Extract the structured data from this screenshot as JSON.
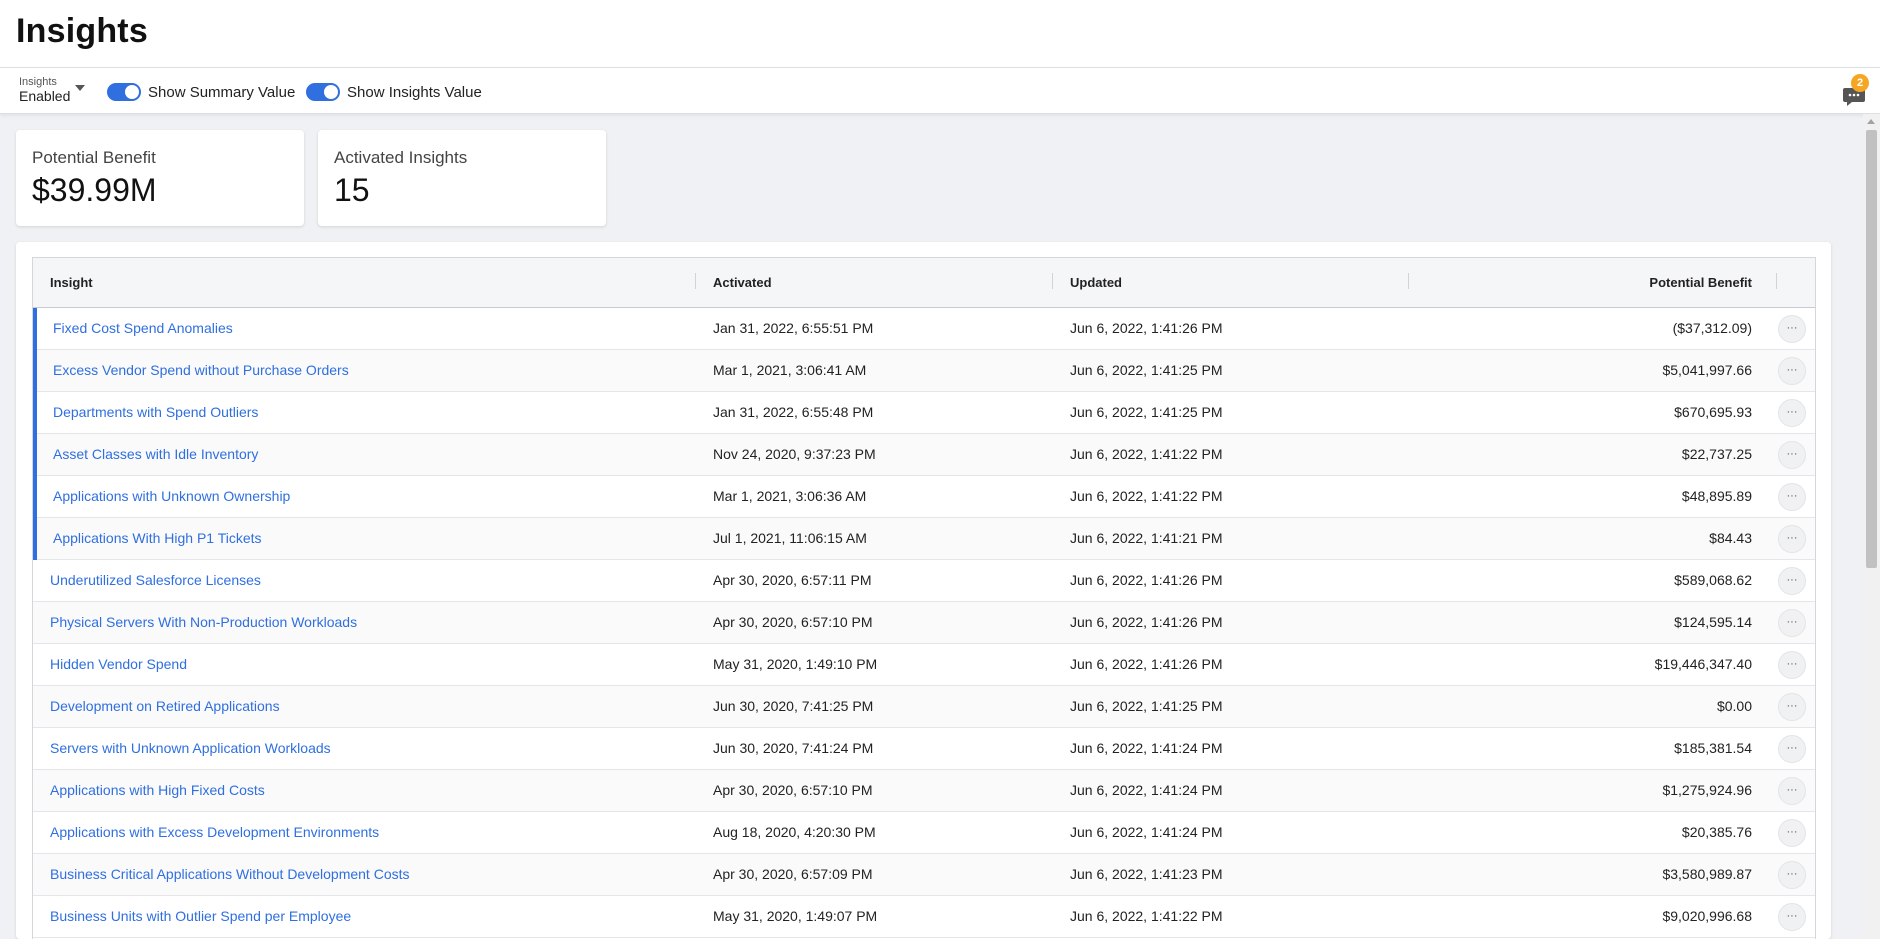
{
  "page": {
    "title": "Insights"
  },
  "toolbar": {
    "dropdown": {
      "label": "Insights",
      "value": "Enabled"
    },
    "toggles": [
      {
        "label": "Show Summary Value",
        "on": true
      },
      {
        "label": "Show Insights Value",
        "on": true
      }
    ],
    "notifications": {
      "count": "2",
      "icon": "chat-icon"
    }
  },
  "summary": {
    "potential_benefit": {
      "label": "Potential Benefit",
      "value": "$39.99M"
    },
    "activated_insights": {
      "label": "Activated Insights",
      "value": "15"
    }
  },
  "table": {
    "columns": [
      "Insight",
      "Activated",
      "Updated",
      "Potential Benefit"
    ],
    "rows": [
      {
        "insight": "Fixed Cost Spend Anomalies",
        "activated": "Jan 31, 2022, 6:55:51 PM",
        "updated": "Jun 6, 2022, 1:41:26 PM",
        "benefit": "($37,312.09)",
        "new": true
      },
      {
        "insight": "Excess Vendor Spend without Purchase Orders",
        "activated": "Mar 1, 2021, 3:06:41 AM",
        "updated": "Jun 6, 2022, 1:41:25 PM",
        "benefit": "$5,041,997.66",
        "new": true
      },
      {
        "insight": "Departments with Spend Outliers",
        "activated": "Jan 31, 2022, 6:55:48 PM",
        "updated": "Jun 6, 2022, 1:41:25 PM",
        "benefit": "$670,695.93",
        "new": true
      },
      {
        "insight": "Asset Classes with Idle Inventory",
        "activated": "Nov 24, 2020, 9:37:23 PM",
        "updated": "Jun 6, 2022, 1:41:22 PM",
        "benefit": "$22,737.25",
        "new": true
      },
      {
        "insight": "Applications with Unknown Ownership",
        "activated": "Mar 1, 2021, 3:06:36 AM",
        "updated": "Jun 6, 2022, 1:41:22 PM",
        "benefit": "$48,895.89",
        "new": true
      },
      {
        "insight": "Applications With High P1 Tickets",
        "activated": "Jul 1, 2021, 11:06:15 AM",
        "updated": "Jun 6, 2022, 1:41:21 PM",
        "benefit": "$84.43",
        "new": true
      },
      {
        "insight": "Underutilized Salesforce Licenses",
        "activated": "Apr 30, 2020, 6:57:11 PM",
        "updated": "Jun 6, 2022, 1:41:26 PM",
        "benefit": "$589,068.62",
        "new": false
      },
      {
        "insight": "Physical Servers With Non-Production Workloads",
        "activated": "Apr 30, 2020, 6:57:10 PM",
        "updated": "Jun 6, 2022, 1:41:26 PM",
        "benefit": "$124,595.14",
        "new": false
      },
      {
        "insight": "Hidden Vendor Spend",
        "activated": "May 31, 2020, 1:49:10 PM",
        "updated": "Jun 6, 2022, 1:41:26 PM",
        "benefit": "$19,446,347.40",
        "new": false
      },
      {
        "insight": "Development on Retired Applications",
        "activated": "Jun 30, 2020, 7:41:25 PM",
        "updated": "Jun 6, 2022, 1:41:25 PM",
        "benefit": "$0.00",
        "new": false
      },
      {
        "insight": "Servers with Unknown Application Workloads",
        "activated": "Jun 30, 2020, 7:41:24 PM",
        "updated": "Jun 6, 2022, 1:41:24 PM",
        "benefit": "$185,381.54",
        "new": false
      },
      {
        "insight": "Applications with High Fixed Costs",
        "activated": "Apr 30, 2020, 6:57:10 PM",
        "updated": "Jun 6, 2022, 1:41:24 PM",
        "benefit": "$1,275,924.96",
        "new": false
      },
      {
        "insight": "Applications with Excess Development Environments",
        "activated": "Aug 18, 2020, 4:20:30 PM",
        "updated": "Jun 6, 2022, 1:41:24 PM",
        "benefit": "$20,385.76",
        "new": false
      },
      {
        "insight": "Business Critical Applications Without Development Costs",
        "activated": "Apr 30, 2020, 6:57:09 PM",
        "updated": "Jun 6, 2022, 1:41:23 PM",
        "benefit": "$3,580,989.87",
        "new": false
      },
      {
        "insight": "Business Units with Outlier Spend per Employee",
        "activated": "May 31, 2020, 1:49:07 PM",
        "updated": "Jun 6, 2022, 1:41:22 PM",
        "benefit": "$9,020,996.68",
        "new": false
      }
    ],
    "row_action_label": "···"
  },
  "colors": {
    "accent": "#2f6fe0",
    "badge": "#f5a623"
  }
}
